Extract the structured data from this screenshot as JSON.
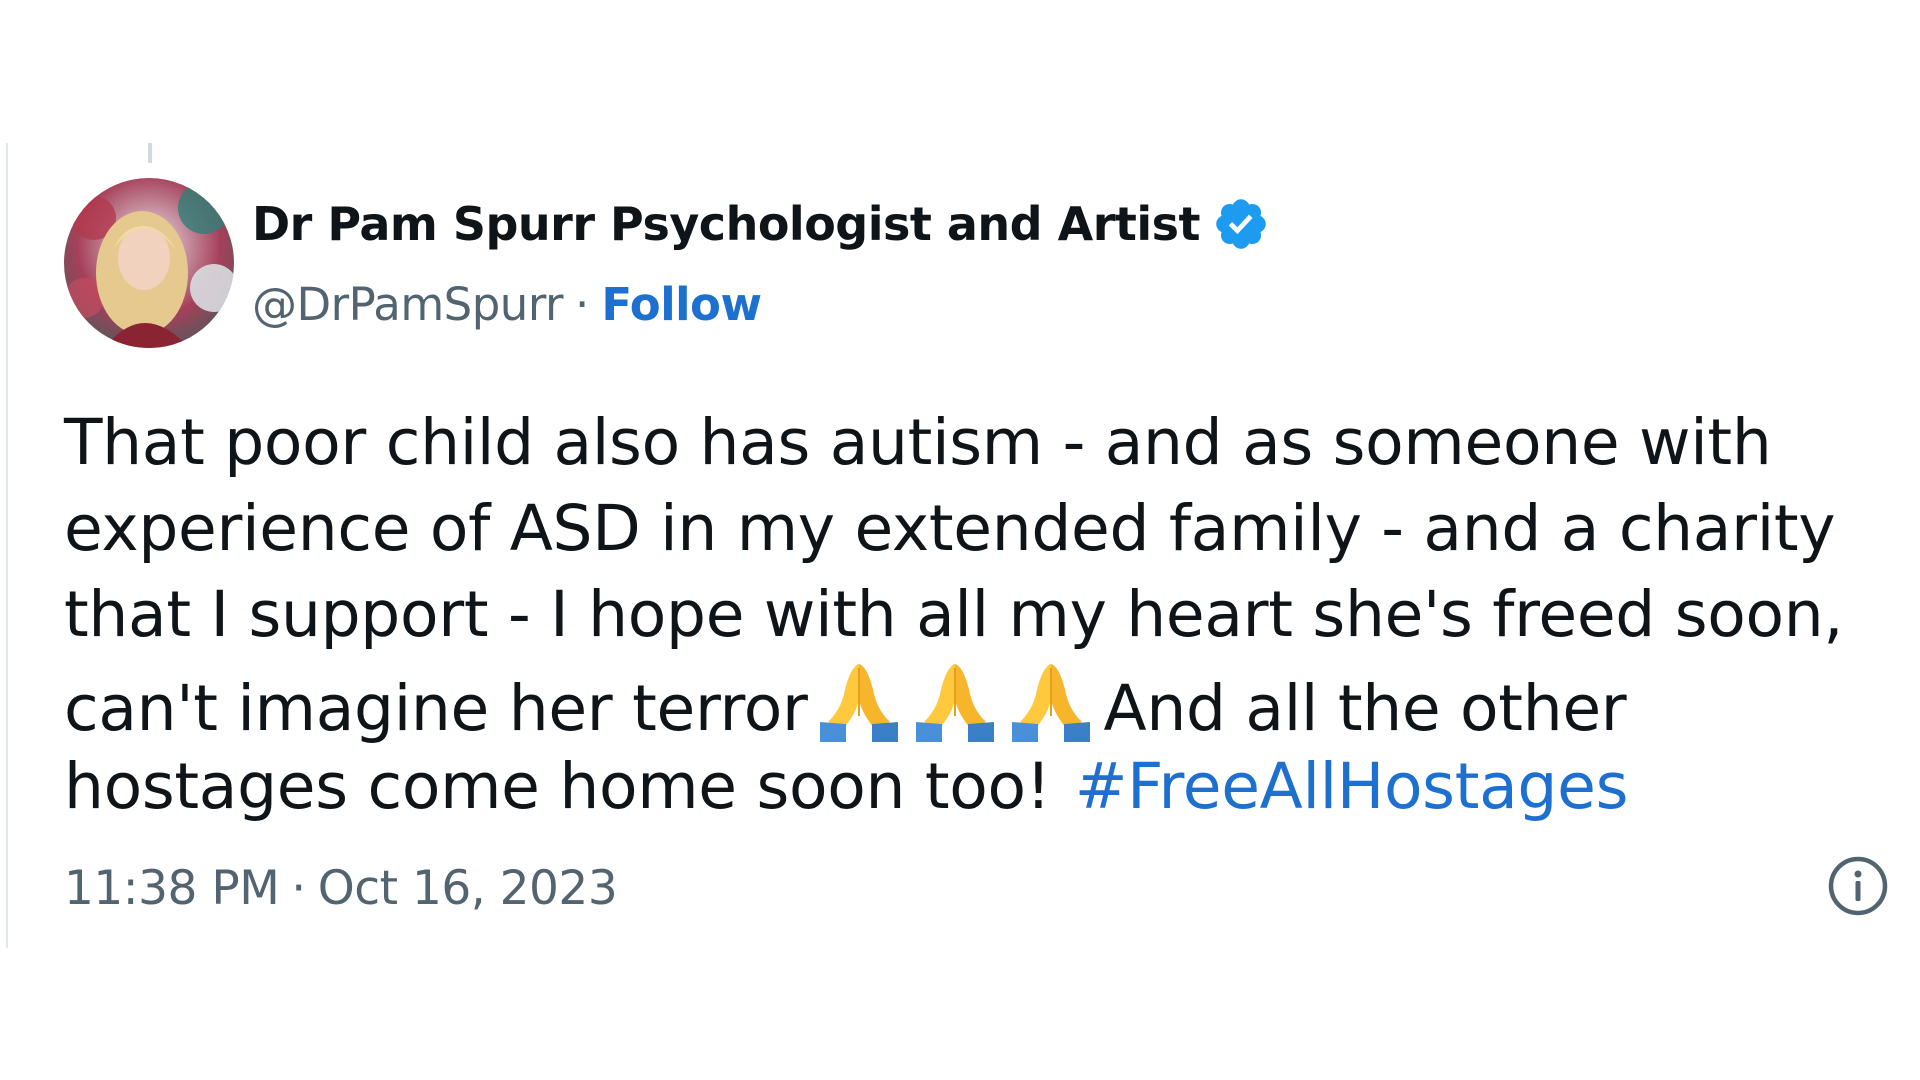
{
  "author": {
    "display_name": "Dr Pam Spurr Psychologist and Artist",
    "handle": "@DrPamSpurr",
    "separator": "·",
    "follow_label": "Follow",
    "verified_icon": "verified-badge-icon",
    "avatar_icon": "profile-avatar"
  },
  "tweet": {
    "lines": [
      "That poor child also has autism - and as someone with",
      "experience of ASD in my extended family - and a charity",
      "that I support - I hope with all my heart she's freed soon,",
      "can't imagine her terror",
      "And all the other",
      "hostages come home soon too!"
    ],
    "emoji_name": "folded-hands-emoji",
    "emoji_count": 3,
    "hashtag": "#FreeAllHostages"
  },
  "timestamp": {
    "time": "11:38 PM",
    "separator": "·",
    "date": "Oct 16, 2023"
  },
  "info_icon": "info-icon",
  "colors": {
    "link": "#1d6fd0",
    "text": "#0f1419",
    "muted": "#536471",
    "verified": "#1d9bf0"
  }
}
